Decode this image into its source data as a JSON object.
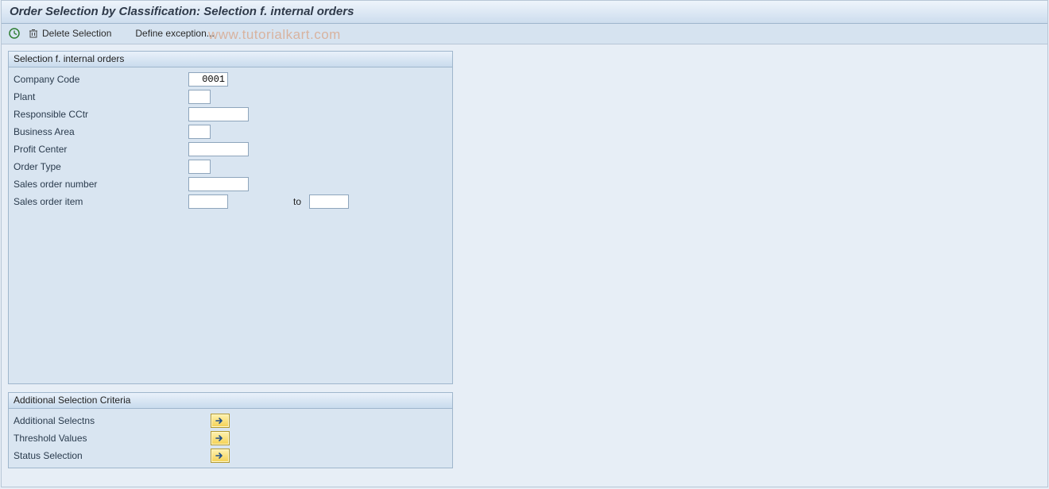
{
  "title": "Order Selection by Classification: Selection f. internal orders",
  "toolbar": {
    "delete_selection": "Delete Selection",
    "define_exception": "Define exception..."
  },
  "watermark": "www.tutorialkart.com",
  "group1": {
    "title": "Selection f. internal orders",
    "fields": {
      "company_code": {
        "label": "Company Code",
        "value": "0001"
      },
      "plant": {
        "label": "Plant",
        "value": ""
      },
      "responsible_cctr": {
        "label": "Responsible CCtr",
        "value": ""
      },
      "business_area": {
        "label": "Business Area",
        "value": ""
      },
      "profit_center": {
        "label": "Profit Center",
        "value": ""
      },
      "order_type": {
        "label": "Order Type",
        "value": ""
      },
      "sales_order_number": {
        "label": "Sales order number",
        "value": ""
      },
      "sales_order_item": {
        "label": "Sales order item",
        "value_from": "",
        "to_label": "to",
        "value_to": ""
      }
    }
  },
  "group2": {
    "title": "Additional Selection Criteria",
    "fields": {
      "additional_selectns": {
        "label": "Additional Selectns"
      },
      "threshold_values": {
        "label": "Threshold Values"
      },
      "status_selection": {
        "label": "Status Selection"
      }
    }
  }
}
